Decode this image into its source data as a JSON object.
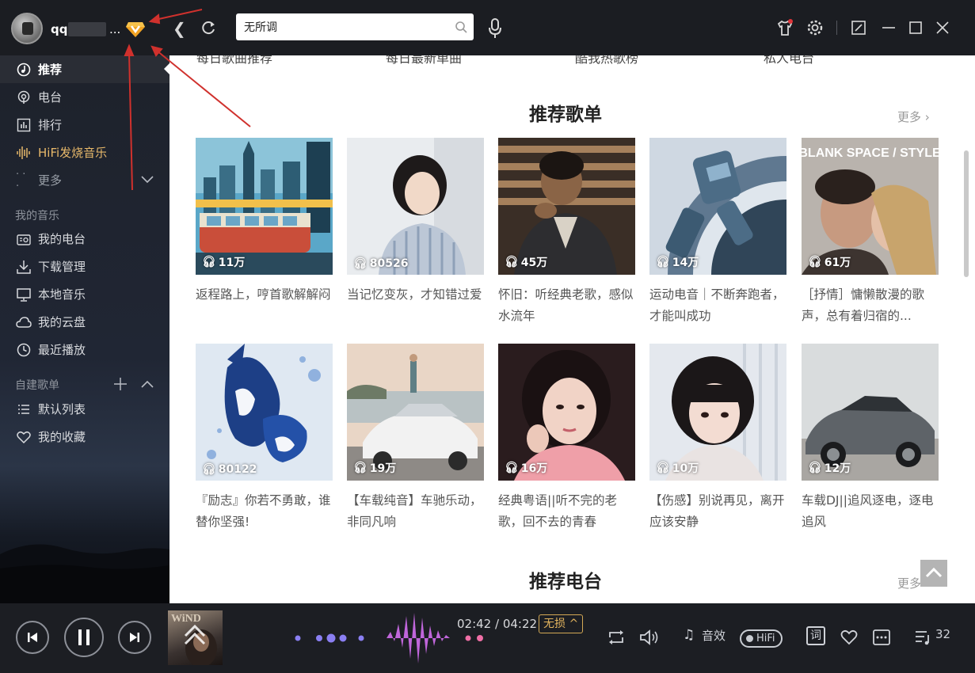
{
  "header": {
    "username_prefix": "qq",
    "username_suffix": "...",
    "search_value": "无所调",
    "accent_color": "#d0312d"
  },
  "sidebar": {
    "items": [
      {
        "label": "推荐",
        "icon": "music-disc-icon"
      },
      {
        "label": "电台",
        "icon": "radio-icon"
      },
      {
        "label": "排行",
        "icon": "chart-icon"
      },
      {
        "label": "HiFi发烧音乐",
        "icon": "hifi-wave-icon"
      },
      {
        "label": "更多",
        "icon": "more-dots-icon"
      }
    ],
    "my_music_title": "我的音乐",
    "my_music": [
      {
        "label": "我的电台",
        "icon": "radio-box-icon"
      },
      {
        "label": "下载管理",
        "icon": "download-icon"
      },
      {
        "label": "本地音乐",
        "icon": "monitor-icon"
      },
      {
        "label": "我的云盘",
        "icon": "cloud-icon"
      },
      {
        "label": "最近播放",
        "icon": "clock-icon"
      }
    ],
    "playlists_title": "自建歌单",
    "playlists": [
      {
        "label": "默认列表",
        "icon": "list-icon"
      },
      {
        "label": "我的收藏",
        "icon": "heart-icon"
      }
    ]
  },
  "main": {
    "top_links": [
      "每日歌曲推荐",
      "每日最新单曲",
      "酷我热歌榜",
      "私人电台"
    ],
    "section1_title": "推荐歌单",
    "more_label": "更多 ›",
    "cards": [
      {
        "plays": "11万",
        "caption": "返程路上，哼首歌解解闷"
      },
      {
        "plays": "80526",
        "caption": "当记忆变灰，才知错过爱"
      },
      {
        "plays": "45万",
        "caption": "怀旧：听经典老歌，感似水流年"
      },
      {
        "plays": "14万",
        "caption": "运动电音｜不断奔跑者，才能叫成功"
      },
      {
        "plays": "61万",
        "caption": "［抒情］慵懒散漫的歌声，总有着归宿的..."
      },
      {
        "plays": "80122",
        "caption": "『励志』你若不勇敢，谁替你坚强!"
      },
      {
        "plays": "19万",
        "caption": "【车载纯音】车驰乐动，非同凡响"
      },
      {
        "plays": "16万",
        "caption": "经典粤语||听不完的老歌，回不去的青春"
      },
      {
        "plays": "10万",
        "caption": "【伤感】别说再见，离开应该安静"
      },
      {
        "plays": "12万",
        "caption": "车载DJ||追风逐电，逐电追风"
      }
    ],
    "cover5_title": "BLANK SPACE / STYLE",
    "section2_title": "推荐电台"
  },
  "player": {
    "time": "02:42 / 04:22",
    "quality": "无损 ^",
    "effects_label": "音效",
    "hifi_label": "HiFi",
    "lyrics_label": "词",
    "queue_count": "32",
    "progress": 0.62
  }
}
